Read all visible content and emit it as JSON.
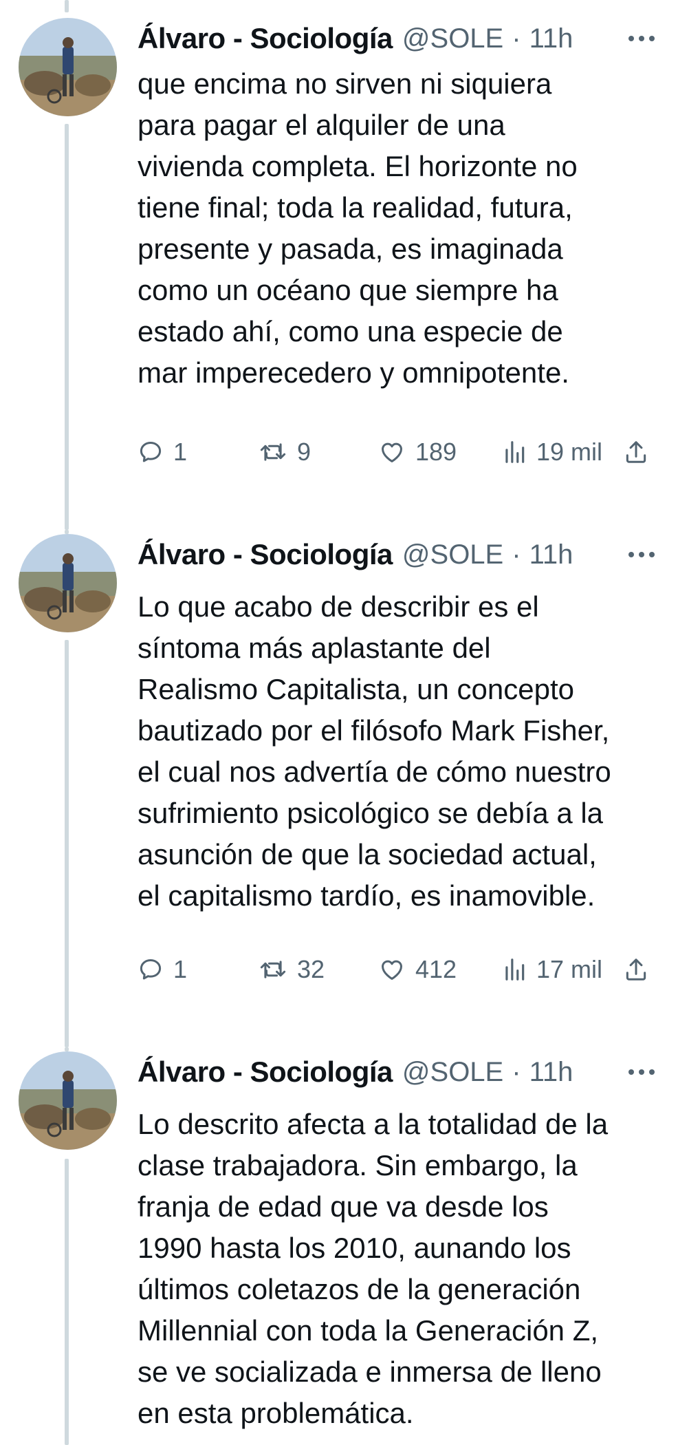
{
  "tweets": [
    {
      "author": {
        "name": "Álvaro - Sociología",
        "handle": "@SOLE",
        "separator": "·",
        "time": "11h"
      },
      "text_lines": [
        "que encima no sirven ni siquiera",
        "para pagar el alquiler de una",
        "vivienda completa. El horizonte no",
        "tiene final; toda la realidad, futura,",
        "presente y pasada, es imaginada",
        "como un océano que siempre ha",
        "estado ahí, como una especie de",
        "mar imperecedero y omnipotente."
      ],
      "stats": {
        "replies": "1",
        "retweets": "9",
        "likes": "189",
        "views": "19 mil"
      }
    },
    {
      "author": {
        "name": "Álvaro - Sociología",
        "handle": "@SOLE",
        "separator": "·",
        "time": "11h"
      },
      "text_lines": [
        "Lo que acabo de describir es el",
        "síntoma más aplastante del",
        "Realismo Capitalista, un concepto",
        "bautizado por el filósofo Mark Fisher,",
        "el cual nos advertía de cómo nuestro",
        "sufrimiento psicológico se debía a la",
        "asunción de que la sociedad actual,",
        "el capitalismo tardío, es inamovible."
      ],
      "stats": {
        "replies": "1",
        "retweets": "32",
        "likes": "412",
        "views": "17 mil"
      }
    },
    {
      "author": {
        "name": "Álvaro - Sociología",
        "handle": "@SOLE",
        "separator": "·",
        "time": "11h"
      },
      "text_lines": [
        "Lo descrito afecta a la totalidad de la",
        "clase trabajadora. Sin embargo, la",
        "franja de edad que va desde los",
        "1990 hasta los 2010, aunando los",
        "últimos coletazos de la generación",
        "Millennial con toda la Generación Z,",
        "se ve socializada e inmersa de lleno",
        "en esta problemática."
      ]
    }
  ],
  "icons": {
    "reply": "reply-icon",
    "retweet": "retweet-icon",
    "like": "heart-icon",
    "views": "views-icon",
    "share": "share-icon",
    "more": "more-icon"
  },
  "colors": {
    "text": "#0f1419",
    "secondary": "#536471",
    "thread_line": "#cfd9de",
    "background": "#ffffff"
  }
}
